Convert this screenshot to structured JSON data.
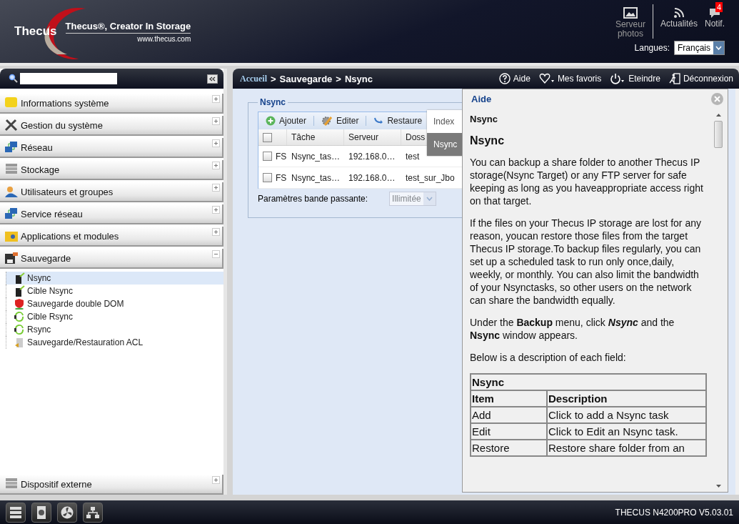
{
  "header": {
    "brand": "Thecus",
    "tagline": "Thecus®, Creator In Storage",
    "url": "www.thecus.com",
    "shortcuts": [
      {
        "label": "Serveur photos",
        "kind": "photo"
      },
      {
        "label": "Actualités",
        "kind": "rss"
      },
      {
        "label": "Notif.",
        "kind": "notif",
        "badge": "4"
      }
    ],
    "language": {
      "label": "Langues:",
      "value": "Français"
    }
  },
  "sidebar": {
    "sections": [
      {
        "label": "Informations système",
        "kind": "info",
        "expanded": false
      },
      {
        "label": "Gestion du système",
        "kind": "tools",
        "expanded": false
      },
      {
        "label": "Réseau",
        "kind": "network",
        "expanded": false
      },
      {
        "label": "Stockage",
        "kind": "storage",
        "expanded": false
      },
      {
        "label": "Utilisateurs et groupes",
        "kind": "users",
        "expanded": false
      },
      {
        "label": "Service réseau",
        "kind": "network",
        "expanded": false
      },
      {
        "label": "Applications et modules",
        "kind": "apps",
        "expanded": false
      },
      {
        "label": "Sauvegarde",
        "kind": "backup",
        "expanded": true,
        "children": [
          {
            "label": "Nsync",
            "kind": "device",
            "selected": true
          },
          {
            "label": "Cible Nsync",
            "kind": "device",
            "selected": false
          },
          {
            "label": "Sauvegarde double DOM",
            "kind": "shield",
            "selected": false
          },
          {
            "label": "Cible Rsync",
            "kind": "sync",
            "selected": false
          },
          {
            "label": "Rsync",
            "kind": "sync",
            "selected": false
          },
          {
            "label": "Sauvegarde/Restauration ACL",
            "kind": "acl",
            "selected": false
          }
        ]
      }
    ],
    "bottom_section": {
      "label": "Dispositif externe",
      "kind": "storage",
      "expanded": false
    }
  },
  "breadcrumb": {
    "items": [
      "Accueil",
      "Sauvegarde",
      "Nsync"
    ],
    "separator": ">"
  },
  "actions": [
    {
      "label": "Aide",
      "kind": "help"
    },
    {
      "label": "Mes favoris",
      "kind": "heart"
    },
    {
      "label": "Eteindre",
      "kind": "power"
    },
    {
      "label": "Déconnexion",
      "kind": "logout"
    }
  ],
  "panel": {
    "title": "Nsync",
    "toolbar": [
      {
        "label": "Ajouter",
        "kind": "add"
      },
      {
        "label": "Editer",
        "kind": "edit"
      },
      {
        "label": "Restaure",
        "kind": "restore"
      }
    ],
    "select_all": {
      "checked": false
    },
    "columns": [
      "Tâche",
      "Serveur",
      "Doss"
    ],
    "rows": [
      {
        "checked": false,
        "type": "FS",
        "task": "Nsync_tas…",
        "server": "192.168.0…",
        "folder": "test"
      },
      {
        "checked": false,
        "type": "FS",
        "task": "Nsync_tas…",
        "server": "192.168.0…",
        "folder": "test_sur_Jbo"
      }
    ],
    "bandwidth": {
      "label": "Paramètres bande passante:",
      "value": "Illimitée",
      "disabled": true
    }
  },
  "help_tabs": [
    {
      "label": "Index",
      "selected": false
    },
    {
      "label": "Nsync",
      "selected": true
    }
  ],
  "help": {
    "title": "Aide",
    "subtitle": "Nsync",
    "heading": "Nsync",
    "paragraphs": [
      "You can backup a share folder to another Thecus IP storage(Nsync Target) or any FTP server for safe keeping as long as you haveappropriate access right on that target.",
      "If the files on your Thecus IP storage are lost for any reason, youcan restore those files from the target Thecus IP storage.To backup files regularly, you can set up a scheduled task to run only once,daily, weekly, or monthly. You can also limit the bandwidth of your Nsynctasks, so other users on the network can share the bandwidth equally.",
      "Under the **Backup** menu, click *Nsync* and the **Nsync** window appears.",
      "Below is a description of each field:"
    ],
    "table": {
      "caption": "Nsync",
      "columns": [
        "Item",
        "Description"
      ],
      "rows": [
        [
          "Add",
          "Click to add a Nsync task"
        ],
        [
          "Edit",
          "Click to Edit an Nsync task."
        ],
        [
          "Restore",
          "Restore share folder from an"
        ]
      ]
    }
  },
  "footer": {
    "tools": [
      {
        "kind": "server"
      },
      {
        "kind": "disk"
      },
      {
        "kind": "fan"
      },
      {
        "kind": "network"
      }
    ],
    "version": "THECUS N4200PRO V5.03.01"
  }
}
